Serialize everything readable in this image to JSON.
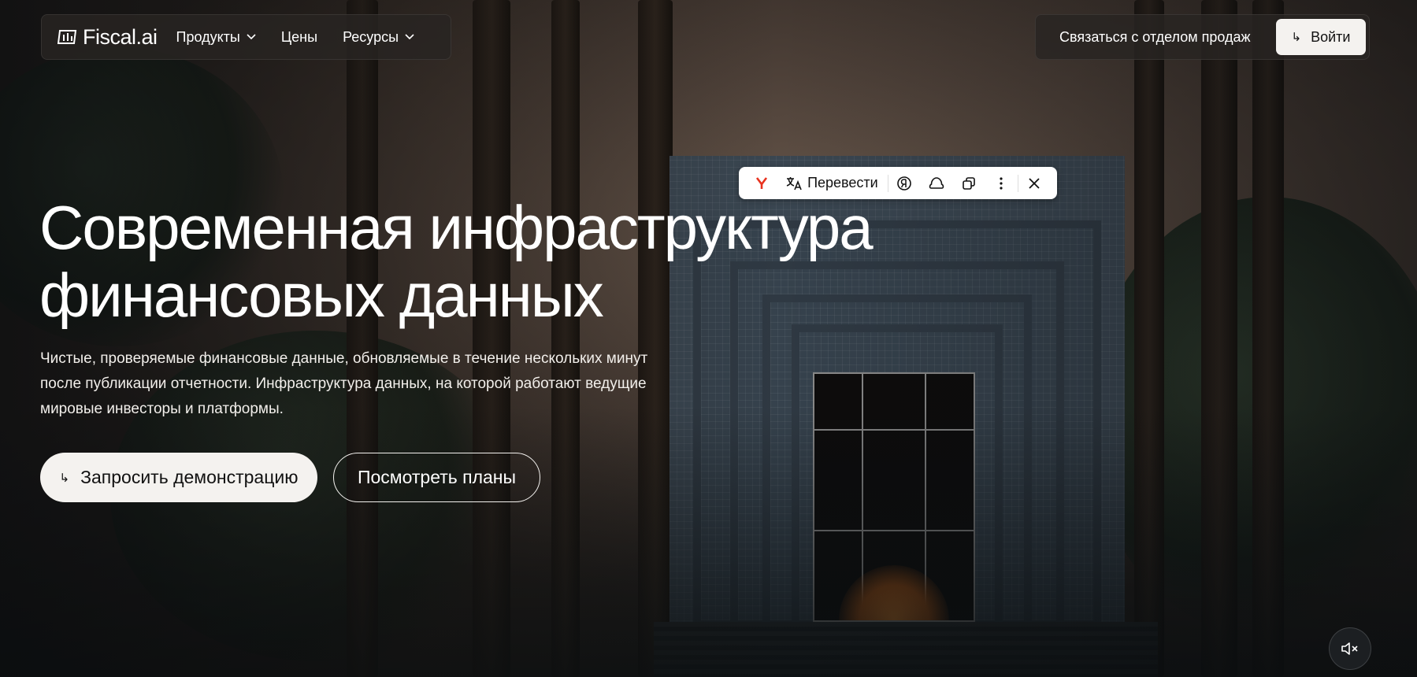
{
  "nav": {
    "logo_text": "Fiscal.ai",
    "items": [
      {
        "label": "Продукты",
        "has_dropdown": true
      },
      {
        "label": "Цены",
        "has_dropdown": false
      },
      {
        "label": "Ресурсы",
        "has_dropdown": true
      }
    ],
    "sales_link": "Связаться с отделом продаж",
    "login_label": "Войти"
  },
  "translate_toolbar": {
    "translate_label": "Перевести",
    "icons": [
      "yandex-browser-icon",
      "translate-icon",
      "alice-icon",
      "cloud-icon",
      "copy-icon",
      "more-icon",
      "close-icon"
    ]
  },
  "hero": {
    "title_line1": "Современная инфраструктура",
    "title_line2": "финансовых данных",
    "subtitle": "Чистые, проверяемые финансовые данные, обновляемые в течение нескольких минут после публикации отчетности. Инфраструктура данных, на которой работают ведущие мировые инвесторы и платформы.",
    "cta_primary": "Запросить демонстрацию",
    "cta_secondary": "Посмотреть планы"
  },
  "arrow_glyph": "↳",
  "colors": {
    "accent_light": "#f4f2ef",
    "nav_bg": "#28242 2",
    "yandex_red": "#e8321e"
  }
}
